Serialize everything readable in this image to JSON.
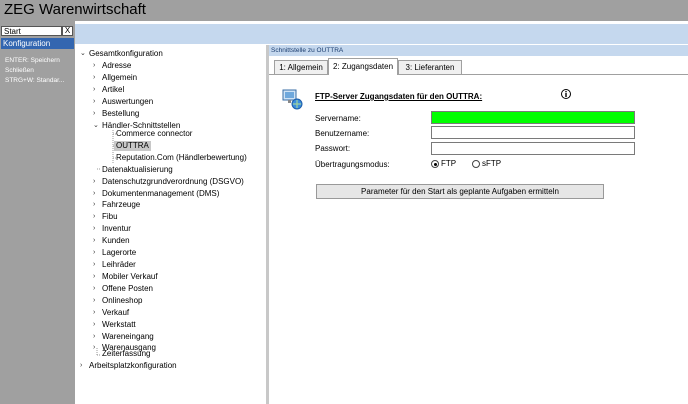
{
  "app": {
    "title": "ZEG Warenwirtschaft"
  },
  "sidebar": {
    "start_tab": "Start",
    "close_label": "X",
    "active_item": "Konfiguration",
    "hints": [
      "ENTER: Speichern",
      "Schließen",
      "STRG+W: Standar..."
    ]
  },
  "tree": {
    "root": "Gesamtkonfiguration",
    "items": [
      "Adresse",
      "Allgemein",
      "Artikel",
      "Auswertungen",
      "Bestellung",
      "Händler-Schnittstellen"
    ],
    "sub_items": [
      "Commerce connector",
      "OUTTRA",
      "Reputation.Com (Händlerbewertung)"
    ],
    "items2": [
      "Datenaktualisierung",
      "Datenschutzgrundverordnung (DSGVO)",
      "Dokumentenmanagement (DMS)",
      "Fahrzeuge",
      "Fibu",
      "Inventur",
      "Kunden",
      "Lagerorte",
      "Leihräder",
      "Mobiler Verkauf",
      "Offene Posten",
      "Onlineshop",
      "Verkauf",
      "Werkstatt",
      "Wareneingang",
      "Warenausgang",
      "Zeiterfassung"
    ],
    "root2": "Arbeitsplatzkonfiguration"
  },
  "panel": {
    "title": "Schnittstelle zu OUTTRA",
    "tabs": [
      "1: Allgemein",
      "2: Zugangsdaten",
      "3: Lieferanten"
    ],
    "active_tab": 1,
    "heading": "FTP-Server Zugangsdaten für den OUTTRA:",
    "labels": {
      "server": "Servername:",
      "user": "Benutzername:",
      "password": "Passwort:",
      "mode": "Übertragungsmodus:"
    },
    "values": {
      "server": "",
      "user": "",
      "password": ""
    },
    "mode_options": [
      "FTP",
      "sFTP"
    ],
    "mode_selected": "FTP",
    "button": "Parameter für den Start als geplante Aufgaben ermitteln"
  },
  "colors": {
    "server_field": "#00ff00",
    "selection": "#3366b0",
    "titlebar": "#a0a0a0",
    "header_strip": "#c5d8ee"
  }
}
